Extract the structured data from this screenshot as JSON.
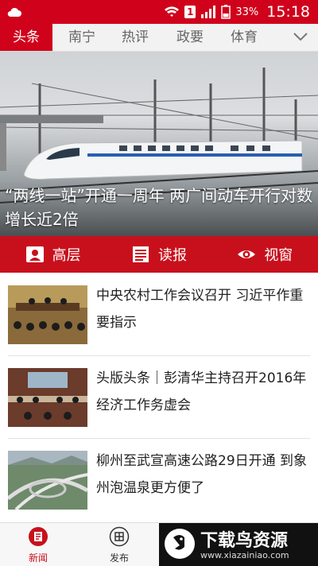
{
  "status_bar": {
    "sim": "1",
    "battery_pct": "33%",
    "time": "15:18"
  },
  "tabs": [
    {
      "label": "头条",
      "active": true
    },
    {
      "label": "南宁",
      "active": false
    },
    {
      "label": "热评",
      "active": false
    },
    {
      "label": "政要",
      "active": false
    },
    {
      "label": "体育",
      "active": false
    }
  ],
  "hero": {
    "caption": "“两线一站”开通一周年 两广间动车开行对数增长近2倍"
  },
  "quick_links": [
    {
      "label": "高层",
      "icon": "person-card-icon"
    },
    {
      "label": "读报",
      "icon": "newspaper-icon"
    },
    {
      "label": "视窗",
      "icon": "eye-icon"
    }
  ],
  "news": [
    {
      "title": "中央农村工作会议召开 习近平作重要指示"
    },
    {
      "title": "头版头条｜彭清华主持召开2016年经济工作务虚会"
    },
    {
      "title": "柳州至武宣高速公路29日开通 到象州泡温泉更方便了"
    }
  ],
  "bottom_nav": [
    {
      "label": "新闻",
      "active": true
    },
    {
      "label": "发布",
      "active": false
    }
  ],
  "watermark": {
    "title": "下载鸟资源",
    "url": "www.xiazainiao.com"
  },
  "colors": {
    "brand": "#d0021b"
  }
}
